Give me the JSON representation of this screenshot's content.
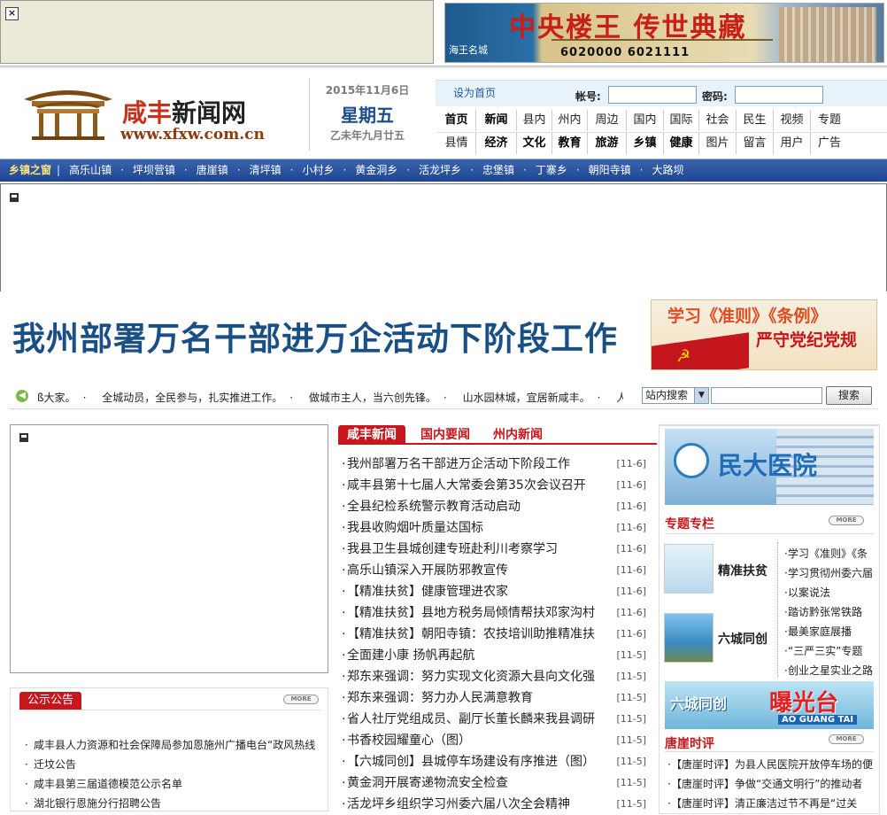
{
  "top_ad": {
    "close_label": "×",
    "banner_title": "中央楼王 传世典藏",
    "banner_brand": "海王名城",
    "banner_phone": "6020000 6021111"
  },
  "logo": {
    "name_red": "咸丰",
    "name_dark": "新闻网",
    "url": "www.xfxw.com.cn"
  },
  "date": {
    "solar": "2015年11月6日",
    "weekday": "星期五",
    "lunar": "乙未年九月廿五"
  },
  "login": {
    "set_home": "设为首页",
    "account_label": "帐号:",
    "password_label": "密码:"
  },
  "nav": {
    "row1": [
      "首页",
      "新闻",
      "县内",
      "州内",
      "周边",
      "国内",
      "国际",
      "社会",
      "民生",
      "视频",
      "专题"
    ],
    "row2": [
      "县情",
      "经济",
      "文化",
      "教育",
      "旅游",
      "乡镇",
      "健康",
      "图片",
      "留言",
      "用户",
      "广告"
    ]
  },
  "town_bar": {
    "title": "乡镇之窗",
    "towns": [
      "高乐山镇",
      "坪坝营镇",
      "唐崖镇",
      "清坪镇",
      "小村乡",
      "黄金洞乡",
      "活龙坪乡",
      "忠堡镇",
      "丁寨乡",
      "朝阳寺镇",
      "大路坝"
    ]
  },
  "headline": "我州部署万名干部进万企活动下阶段工作",
  "study_ad": {
    "line1": "学习《准则》《条例》",
    "line2": "严守党纪党规"
  },
  "ticker": {
    "items": [
      "ß大家。",
      "全城动员，全民参与，扎实推进工作。",
      "做城市主人，当六创先锋。",
      "山水园林城，宜居新咸丰。",
      "人"
    ]
  },
  "search": {
    "scope": "站内搜索",
    "button": "搜索"
  },
  "notice": {
    "title": "公示公告",
    "more": "MORE",
    "items": [
      "咸丰县人力资源和社会保障局参加恩施州广播电台“政风热线",
      "迁坟公告",
      "咸丰县第三届道德模范公示名单",
      "湖北银行恩施分行招聘公告"
    ]
  },
  "news": {
    "tabs": [
      "咸丰新闻",
      "国内要闻",
      "州内新闻"
    ],
    "items": [
      {
        "title": "我州部署万名干部进万企活动下阶段工作",
        "date": "[11-6]"
      },
      {
        "title": "咸丰县第十七届人大常委会第35次会议召开",
        "date": "[11-6]"
      },
      {
        "title": "全县纪检系统警示教育活动启动",
        "date": "[11-6]"
      },
      {
        "title": "我县收购烟叶质量达国标",
        "date": "[11-6]"
      },
      {
        "title": "我县卫生县城创建专班赴利川考察学习",
        "date": "[11-6]"
      },
      {
        "title": "高乐山镇深入开展防邪教宣传",
        "date": "[11-6]"
      },
      {
        "title": "【精准扶贫】健康管理进农家",
        "date": "[11-6]"
      },
      {
        "title": "【精准扶贫】县地方税务局倾情帮扶邓家沟村",
        "date": "[11-6]"
      },
      {
        "title": "【精准扶贫】朝阳寺镇：农技培训助推精准扶",
        "date": "[11-6]"
      },
      {
        "title": "全面建小康 扬帆再起航",
        "date": "[11-5]"
      },
      {
        "title": "郑东来强调：努力实现文化资源大县向文化强",
        "date": "[11-5]"
      },
      {
        "title": "郑东来强调：努力办人民满意教育",
        "date": "[11-5]"
      },
      {
        "title": "省人社厅党组成员、副厅长董长麟来我县调研",
        "date": "[11-5]"
      },
      {
        "title": "书香校园耀童心（图）",
        "date": "[11-5]"
      },
      {
        "title": "【六城同创】县城停车场建设有序推进（图）",
        "date": "[11-5]"
      },
      {
        "title": "黄金洞开展寄递物流安全检查",
        "date": "[11-5]"
      },
      {
        "title": "活龙坪乡组织学习州委六届八次全会精神",
        "date": "[11-5]"
      }
    ]
  },
  "right": {
    "hospital_ad": "民大医院",
    "special_title": "专题专栏",
    "more": "MORE",
    "specials": [
      "精准扶贫",
      "六城同创"
    ],
    "special_links": [
      "学习《准则》《条",
      "学习贯彻州委六届",
      "以案说法",
      "踏访黔张常铁路",
      "最美家庭展播",
      "“三严三实”专题",
      "创业之星实业之路"
    ],
    "expose_ad": {
      "left": "六城同创",
      "main": "曝光台",
      "sub": "AO GUANG TAI"
    },
    "comment_title": "唐崖时评",
    "comments": [
      "【唐崖时评】为县人民医院开放停车场的便",
      "【唐崖时评】争做“交通文明行”的推动者",
      "【唐崖时评】清正廉洁过节不再是“过关"
    ]
  }
}
